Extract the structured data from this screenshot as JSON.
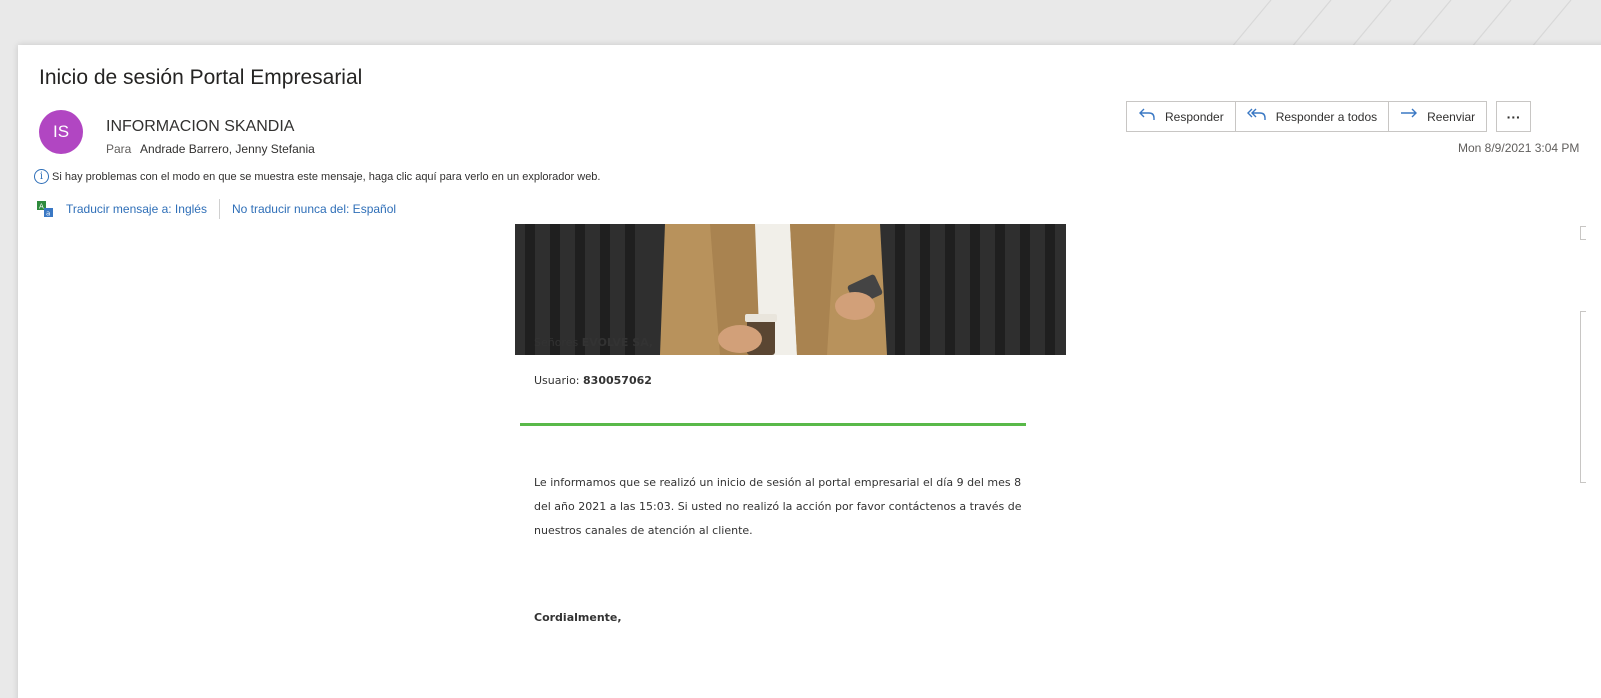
{
  "message": {
    "subject": "Inicio de sesión Portal Empresarial",
    "avatar_initials": "IS",
    "avatar_color": "#b146c2",
    "sender": "INFORMACION SKANDIA",
    "to_label": "Para",
    "to_value": "Andrade Barrero, Jenny Stefania",
    "date": "Mon 8/9/2021 3:04 PM"
  },
  "actions": {
    "reply": "Responder",
    "reply_all": "Responder a todos",
    "forward": "Reenviar",
    "more": "···"
  },
  "notice": {
    "text": "Si hay problemas con el modo en que se muestra este mensaje, haga clic aquí para verlo en un explorador web."
  },
  "translate": {
    "translate_link": "Traducir mensaje a: Inglés",
    "never_link": "No traducir nunca del: Español"
  },
  "email_body": {
    "greeting_prefix": "Señores ",
    "company": "EVOLVE SA,",
    "user_label": "Usuario: ",
    "user_value": "830057062",
    "paragraph": "Le informamos que se realizó un inicio de sesión al portal empresarial el día 9 del mes 8 del año 2021 a las 15:03. Si usted no realizó la acción por favor contáctenos a través de nuestros canales de atención al cliente.",
    "closing": "Cordialmente,",
    "accent_color": "#59b949"
  },
  "icons": {
    "reply": "reply-icon",
    "reply_all": "reply-all-icon",
    "forward": "forward-icon",
    "info": "info-icon",
    "translate": "translate-icon"
  }
}
